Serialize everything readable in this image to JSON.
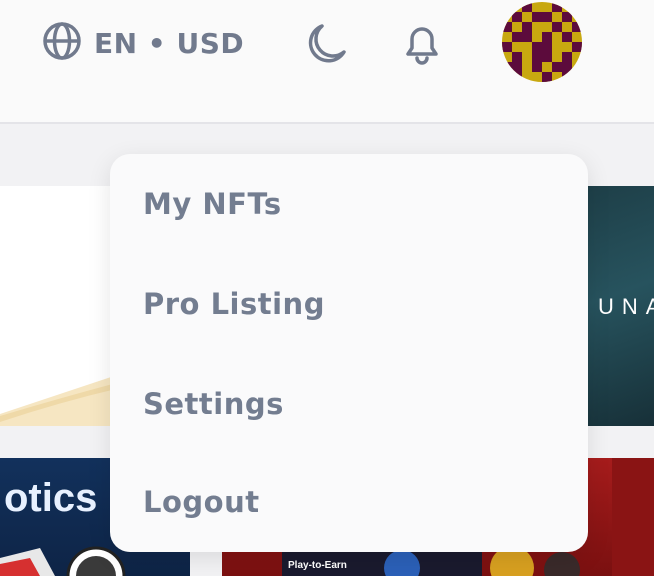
{
  "header": {
    "locale_label": "EN • USD",
    "icons": [
      "globe-icon",
      "moon-icon",
      "bell-icon",
      "avatar"
    ]
  },
  "background_cards": {
    "right_card_text": "UNA",
    "lower_left_text": "otics",
    "lower_right_text": "Play-to-Earn"
  },
  "menu": {
    "items": [
      {
        "label": "My NFTs"
      },
      {
        "label": "Pro Listing"
      },
      {
        "label": "Settings"
      },
      {
        "label": "Logout"
      }
    ]
  },
  "colors": {
    "text_muted": "#737d90",
    "avatar_dark": "#5c0b3c",
    "avatar_gold": "#c8a810"
  }
}
